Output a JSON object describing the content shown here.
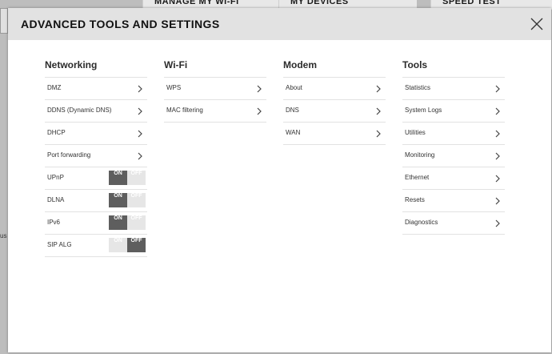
{
  "background": {
    "tabs": [
      "MANAGE MY WI-FI",
      "MY DEVICES",
      "SPEED TEST"
    ],
    "left_text": "us"
  },
  "modal": {
    "title": "ADVANCED TOOLS AND SETTINGS"
  },
  "columns": [
    {
      "title": "Networking",
      "items": [
        {
          "label": "DMZ",
          "kind": "link"
        },
        {
          "label": "DDNS (Dynamic DNS)",
          "kind": "link"
        },
        {
          "label": "DHCP",
          "kind": "link"
        },
        {
          "label": "Port forwarding",
          "kind": "link"
        },
        {
          "label": "UPnP",
          "kind": "toggle",
          "state": "on"
        },
        {
          "label": "DLNA",
          "kind": "toggle",
          "state": "on"
        },
        {
          "label": "IPv6",
          "kind": "toggle",
          "state": "on"
        },
        {
          "label": "SIP ALG",
          "kind": "toggle",
          "state": "off"
        }
      ]
    },
    {
      "title": "Wi-Fi",
      "items": [
        {
          "label": "WPS",
          "kind": "link"
        },
        {
          "label": "MAC filtering",
          "kind": "link"
        }
      ]
    },
    {
      "title": "Modem",
      "items": [
        {
          "label": "About",
          "kind": "link"
        },
        {
          "label": "DNS",
          "kind": "link"
        },
        {
          "label": "WAN",
          "kind": "link"
        }
      ]
    },
    {
      "title": "Tools",
      "items": [
        {
          "label": "Statistics",
          "kind": "link"
        },
        {
          "label": "System Logs",
          "kind": "link"
        },
        {
          "label": "Utilities",
          "kind": "link"
        },
        {
          "label": "Monitoring",
          "kind": "link"
        },
        {
          "label": "Ethernet",
          "kind": "link"
        },
        {
          "label": "Resets",
          "kind": "link"
        },
        {
          "label": "Diagnostics",
          "kind": "link"
        }
      ]
    }
  ],
  "toggle_labels": {
    "on": "ON",
    "off": "OFF"
  },
  "colors": {
    "header_bg": "#e2e2e2",
    "toggle_active": "#5e5e5e",
    "toggle_inactive": "#e6e6e6"
  }
}
